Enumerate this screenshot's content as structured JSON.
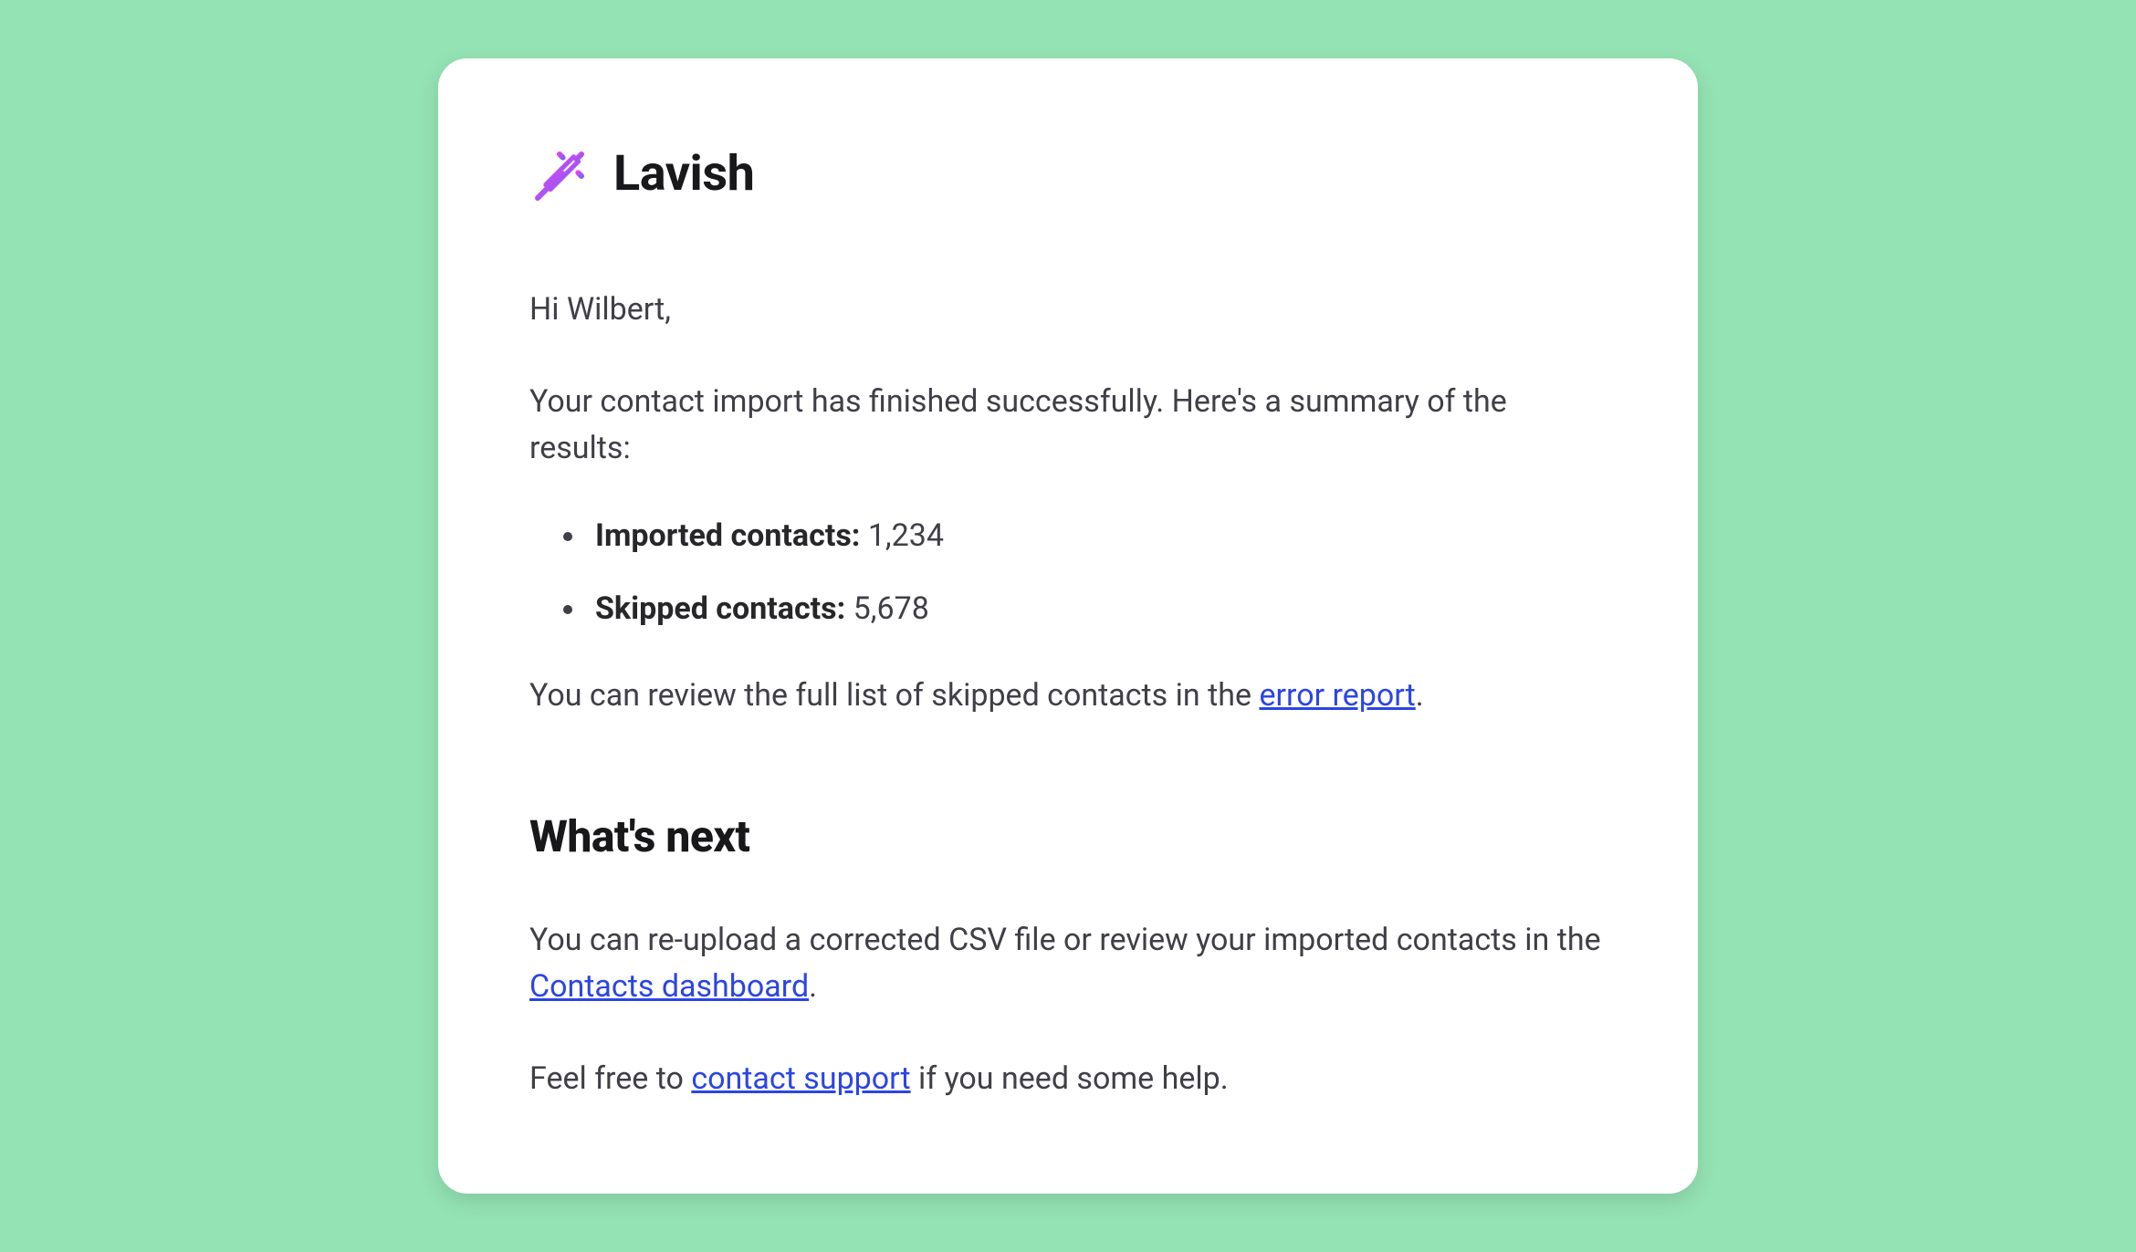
{
  "header": {
    "brand": "Lavish"
  },
  "greeting": "Hi Wilbert,",
  "intro": "Your contact import has finished successfully. Here's a summary of the results:",
  "stats": {
    "imported_label": "Imported contacts:",
    "imported_value": "1,234",
    "skipped_label": "Skipped contacts:",
    "skipped_value": "5,678"
  },
  "review": {
    "before": "You can review the full list of skipped contacts in the ",
    "link": "error report",
    "after": "."
  },
  "next": {
    "heading": "What's next",
    "p1_before": "You can re-upload a corrected CSV file or review your imported contacts in the ",
    "p1_link": "Contacts dashboard",
    "p1_after": ".",
    "p2_before": "Feel free to ",
    "p2_link": "contact support",
    "p2_after": " if you need some help."
  }
}
